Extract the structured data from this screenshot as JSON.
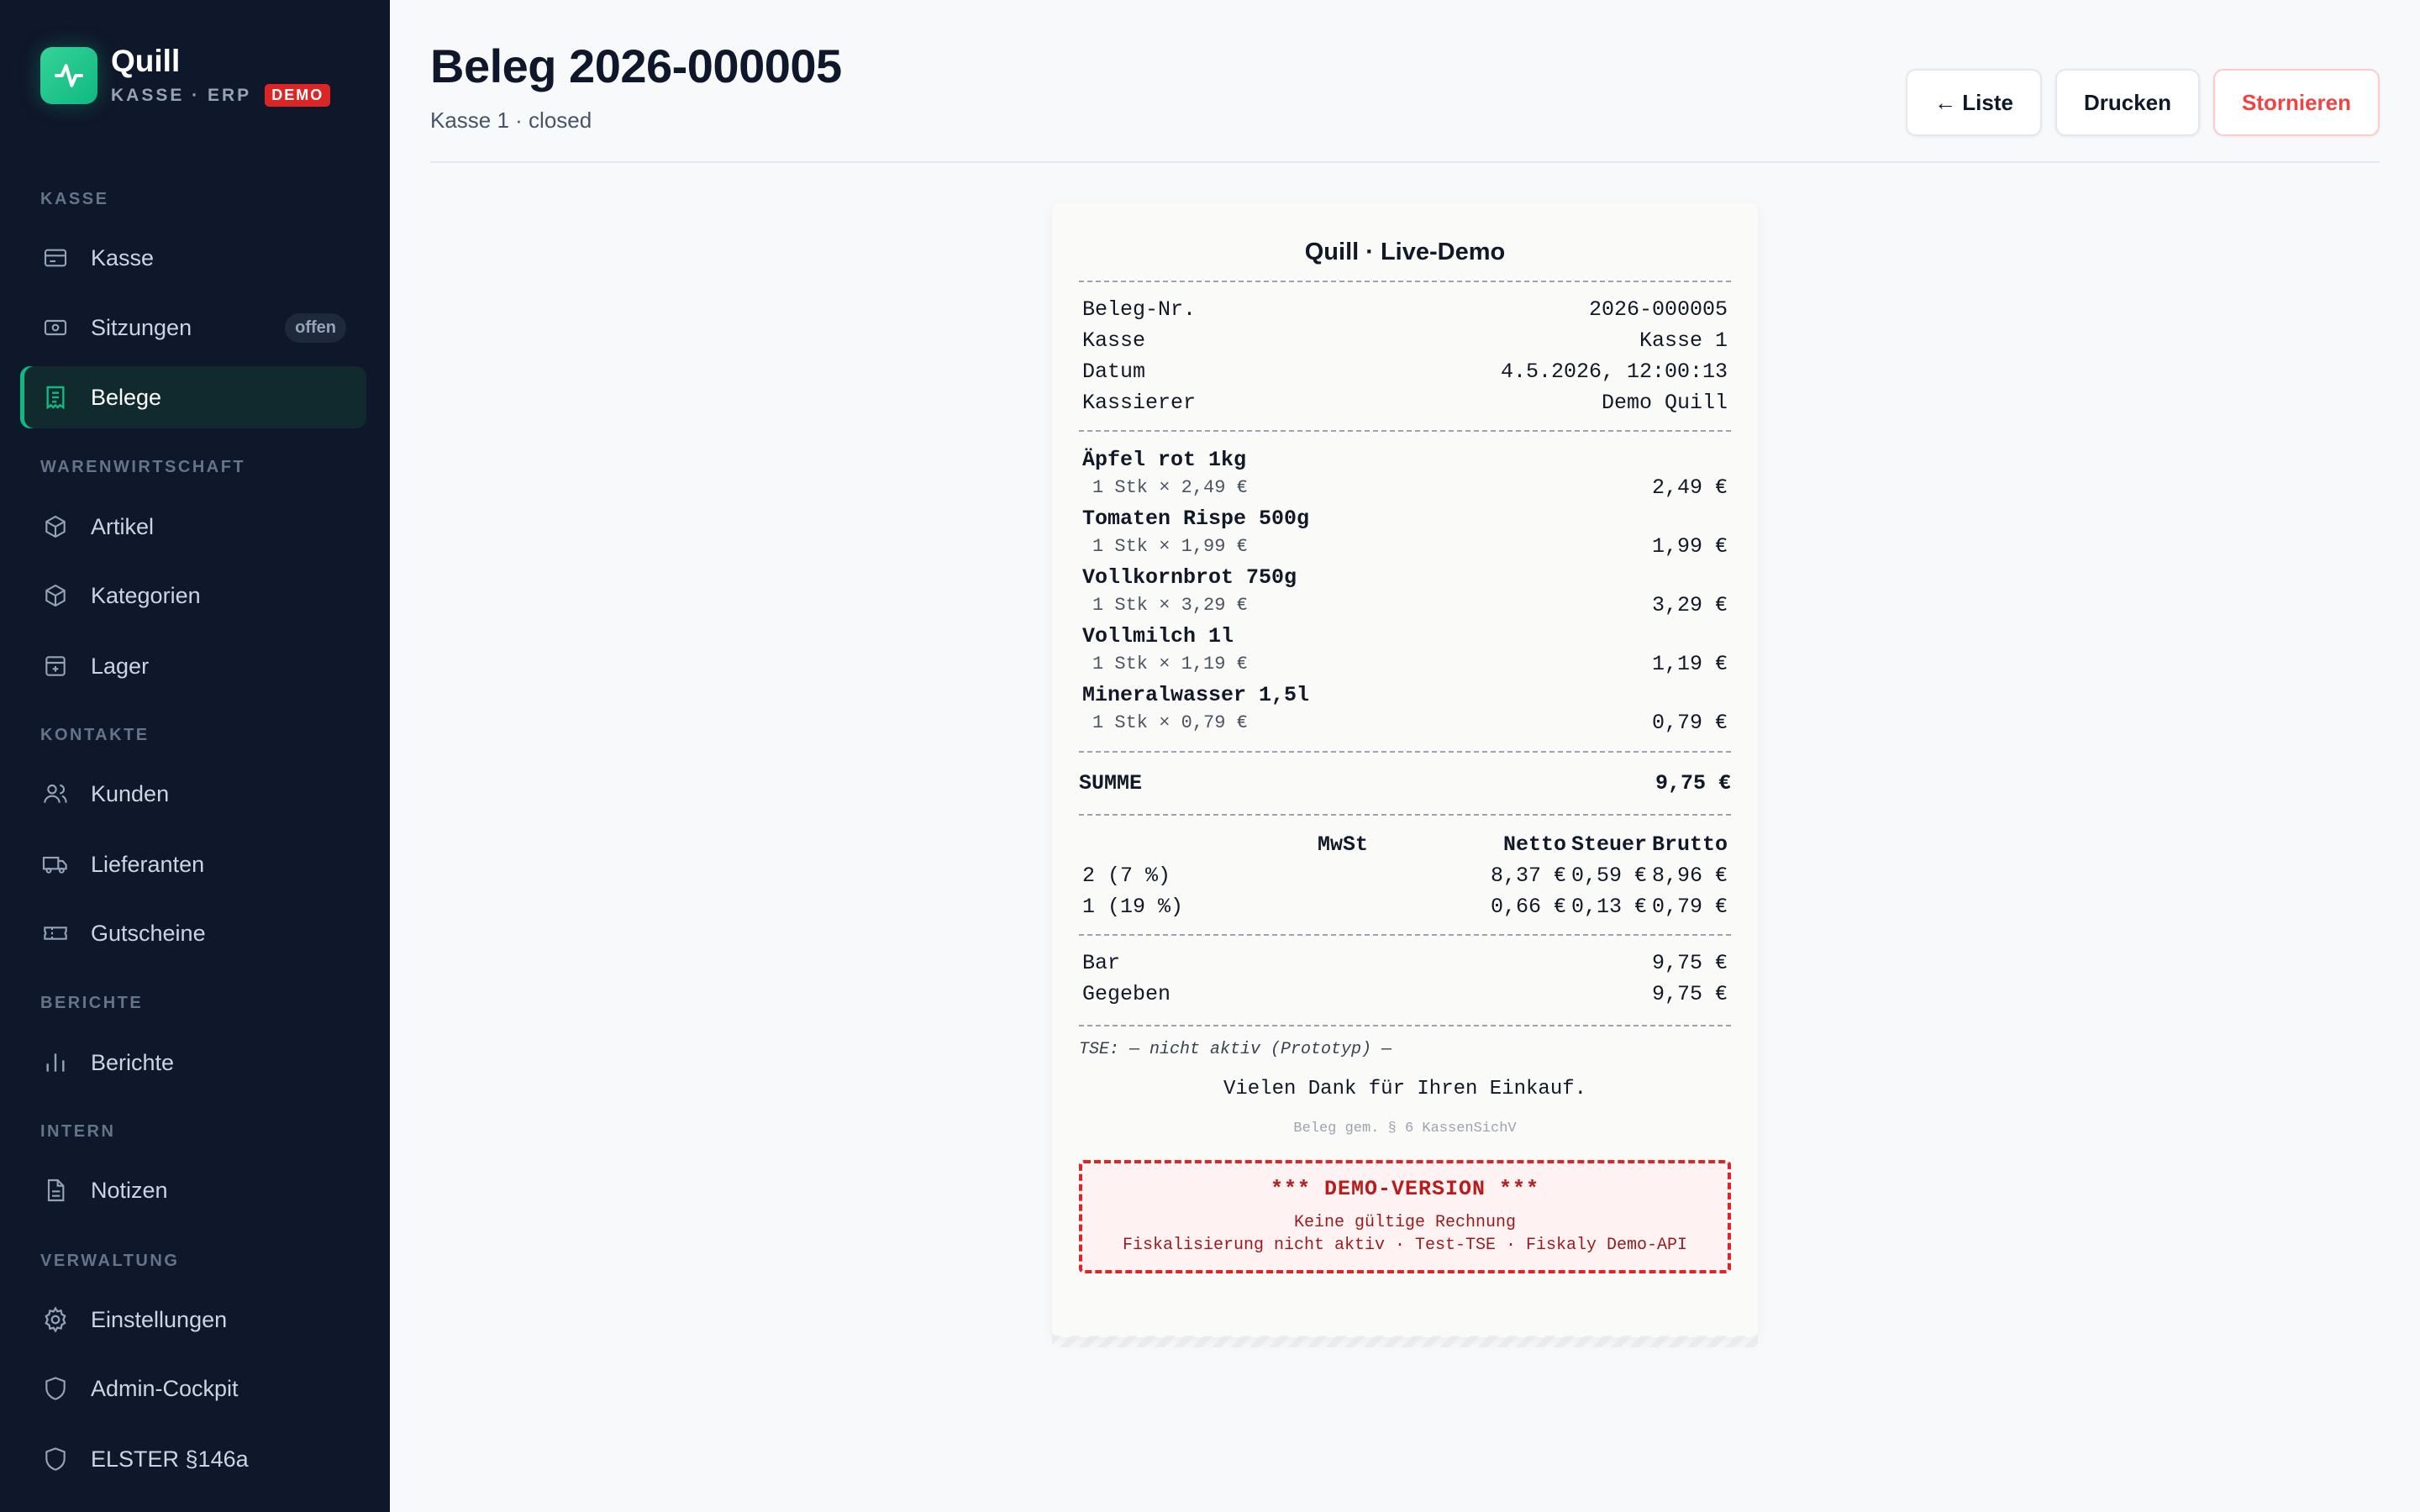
{
  "brand": {
    "name": "Quill",
    "subtitle": "KASSE · ERP",
    "badge": "DEMO"
  },
  "sidebar": {
    "sections": [
      "KASSE",
      "WARENWIRTSCHAFT",
      "KONTAKTE",
      "BERICHTE",
      "INTERN",
      "VERWALTUNG"
    ],
    "items": [
      {
        "label": "Kasse",
        "icon": "register-icon"
      },
      {
        "label": "Sitzungen",
        "icon": "cash-icon",
        "badge": "offen"
      },
      {
        "label": "Belege",
        "icon": "receipt-icon",
        "active": true
      },
      {
        "label": "Artikel",
        "icon": "box-icon"
      },
      {
        "label": "Kategorien",
        "icon": "box-icon"
      },
      {
        "label": "Lager",
        "icon": "archive-icon"
      },
      {
        "label": "Kunden",
        "icon": "users-icon"
      },
      {
        "label": "Lieferanten",
        "icon": "truck-icon"
      },
      {
        "label": "Gutscheine",
        "icon": "ticket-icon"
      },
      {
        "label": "Berichte",
        "icon": "bar-chart-icon"
      },
      {
        "label": "Notizen",
        "icon": "document-icon"
      },
      {
        "label": "Einstellungen",
        "icon": "gear-icon"
      },
      {
        "label": "Admin-Cockpit",
        "icon": "shield-icon"
      },
      {
        "label": "ELSTER §146a",
        "icon": "shield-icon"
      }
    ]
  },
  "header": {
    "title": "Beleg 2026-000005",
    "subtitle": "Kasse 1 · closed",
    "buttons": {
      "back": "← Liste",
      "print": "Drucken",
      "cancel": "Stornieren"
    }
  },
  "receipt": {
    "title": "Quill · Live-Demo",
    "meta": [
      {
        "label": "Beleg-Nr.",
        "value": "2026-000005"
      },
      {
        "label": "Kasse",
        "value": "Kasse 1"
      },
      {
        "label": "Datum",
        "value": "4.5.2026, 12:00:13"
      },
      {
        "label": "Kassierer",
        "value": "Demo Quill"
      }
    ],
    "items": [
      {
        "name": "Äpfel rot 1kg",
        "qty": "1 Stk × 2,49 €",
        "price": "2,49 €"
      },
      {
        "name": "Tomaten Rispe 500g",
        "qty": "1 Stk × 1,99 €",
        "price": "1,99 €"
      },
      {
        "name": "Vollkornbrot 750g",
        "qty": "1 Stk × 3,29 €",
        "price": "3,29 €"
      },
      {
        "name": "Vollmilch 1l",
        "qty": "1 Stk × 1,19 €",
        "price": "1,19 €"
      },
      {
        "name": "Mineralwasser 1,5l",
        "qty": "1 Stk × 0,79 €",
        "price": "0,79 €"
      }
    ],
    "sum": {
      "label": "SUMME",
      "value": "9,75 €"
    },
    "tax": {
      "headers": [
        "",
        "MwSt",
        "Netto",
        "Steuer",
        "Brutto"
      ],
      "rows": [
        {
          "label": "2 (7 %)",
          "netto": "8,37 €",
          "steuer": "0,59 €",
          "brutto": "8,96 €"
        },
        {
          "label": "1 (19 %)",
          "netto": "0,66 €",
          "steuer": "0,13 €",
          "brutto": "0,79 €"
        }
      ]
    },
    "payment": [
      {
        "label": "Bar",
        "value": "9,75 €"
      },
      {
        "label": "Gegeben",
        "value": "9,75 €"
      }
    ],
    "tse": "TSE: — nicht aktiv (Prototyp) —",
    "thanks": "Vielen Dank für Ihren Einkauf.",
    "legal": "Beleg gem. § 6 KassenSichV",
    "demo": {
      "title": "*** DEMO-VERSION ***",
      "line1": "Keine gültige Rechnung",
      "line2": "Fiskalisierung nicht aktiv · Test-TSE · Fiskaly Demo-API"
    }
  },
  "colors": {
    "accent": "#10b981",
    "sidebar_bg": "#0f172a",
    "danger": "#dc2626"
  }
}
